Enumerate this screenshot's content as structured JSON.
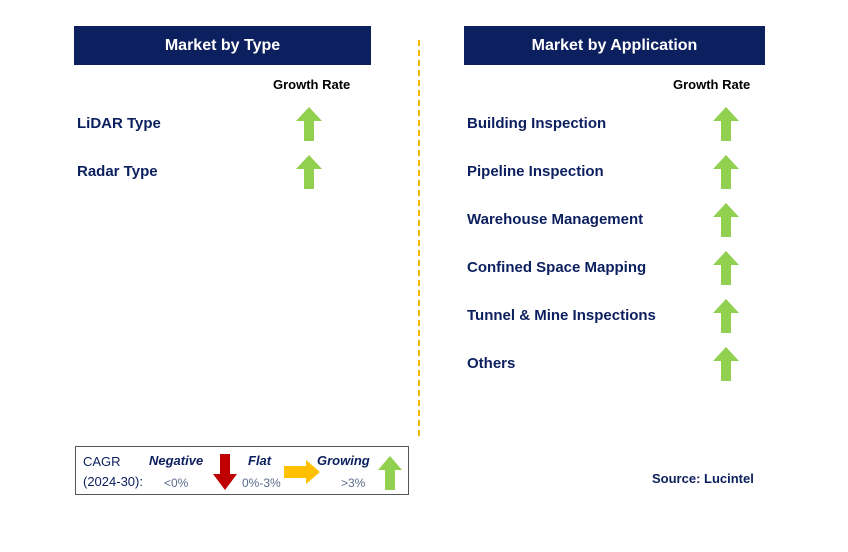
{
  "type_panel": {
    "title": "Market by Type",
    "column": "Growth Rate",
    "items": [
      {
        "label": "LiDAR Type",
        "trend": "growing"
      },
      {
        "label": "Radar Type",
        "trend": "growing"
      }
    ]
  },
  "application_panel": {
    "title": "Market by Application",
    "column": "Growth Rate",
    "items": [
      {
        "label": "Building Inspection",
        "trend": "growing"
      },
      {
        "label": "Pipeline Inspection",
        "trend": "growing"
      },
      {
        "label": "Warehouse Management",
        "trend": "growing"
      },
      {
        "label": "Confined Space Mapping",
        "trend": "growing"
      },
      {
        "label": "Tunnel & Mine Inspections",
        "trend": "growing"
      },
      {
        "label": "Others",
        "trend": "growing"
      }
    ]
  },
  "legend": {
    "cagr": "CAGR",
    "period": "(2024-30):",
    "negative": "Negative",
    "negative_range": "<0%",
    "flat": "Flat",
    "flat_range": "0%-3%",
    "growing": "Growing",
    "growing_range": ">3%"
  },
  "source": "Source: Lucintel",
  "colors": {
    "header": "#0c1f5e",
    "growing": "#92d050",
    "flat": "#ffc000",
    "negative": "#c00000",
    "divider": "#f5b800"
  }
}
